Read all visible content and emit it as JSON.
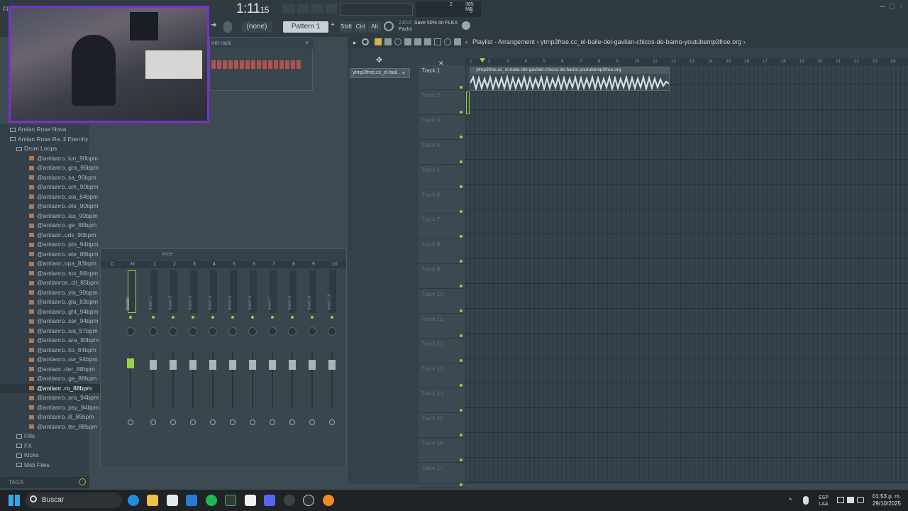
{
  "app": {
    "title": "FL",
    "clock": "1:11",
    "clock_small": "15",
    "cpu": "2",
    "mem": "385 MB",
    "mem2": "0"
  },
  "toolbar": {
    "pattern_label": "Pattern 1",
    "none_label": "(none)",
    "shift": "Shift",
    "ctrl": "Ctrl",
    "alt": "Alt",
    "promo_date": "23/10",
    "promo_text": "Save 50% on FLEX",
    "promo_sub": "Packs"
  },
  "channel_rack": {
    "title": "nel rack"
  },
  "browser": {
    "items": [
      {
        "label": "Antian Rose Nova",
        "kind": "folder",
        "indent": 1
      },
      {
        "label": "Antian Rose Re..ll Eternity",
        "kind": "folder-open",
        "indent": 1
      },
      {
        "label": "Drum Loops",
        "kind": "folder-open",
        "indent": 2
      },
      {
        "label": "@antianro..lun_90bpm",
        "kind": "file",
        "indent": 3
      },
      {
        "label": "@antianro..gra_96bpm",
        "kind": "file",
        "indent": 3
      },
      {
        "label": "@antianro..sa_96bpm",
        "kind": "file",
        "indent": 3
      },
      {
        "label": "@antianro..um_90bpm",
        "kind": "file",
        "indent": 3
      },
      {
        "label": "@antianro..ola_84bpm",
        "kind": "file",
        "indent": 3
      },
      {
        "label": "@antianro..ote_90bpm",
        "kind": "file",
        "indent": 3
      },
      {
        "label": "@antianro..las_90bpm",
        "kind": "file",
        "indent": 3
      },
      {
        "label": "@antianro..ge_88bpm",
        "kind": "file",
        "indent": 3
      },
      {
        "label": "@antianr..uds_90bpm",
        "kind": "file",
        "indent": 3
      },
      {
        "label": "@antianro..pto_94bpm",
        "kind": "file",
        "indent": 3
      },
      {
        "label": "@antianro..ate_88bpm",
        "kind": "file",
        "indent": 3
      },
      {
        "label": "@antianr..opa_83bpm",
        "kind": "file",
        "indent": 3
      },
      {
        "label": "@antianro..tus_86bpm",
        "kind": "file",
        "indent": 3
      },
      {
        "label": "@antianros..cll_85bpm",
        "kind": "file",
        "indent": 3
      },
      {
        "label": "@antianro..yla_90bpm",
        "kind": "file",
        "indent": 3
      },
      {
        "label": "@antianro..gla_83bpm",
        "kind": "file",
        "indent": 3
      },
      {
        "label": "@antianro..ght_94bpm",
        "kind": "file",
        "indent": 3
      },
      {
        "label": "@antianro..sar_94bpm",
        "kind": "file",
        "indent": 3
      },
      {
        "label": "@antianro..iva_87bpm",
        "kind": "file",
        "indent": 3
      },
      {
        "label": "@antianro..ara_90bpm",
        "kind": "file",
        "indent": 3
      },
      {
        "label": "@antianro..ito_84bpm",
        "kind": "file",
        "indent": 3
      },
      {
        "label": "@antianro..ow_94bpm",
        "kind": "file",
        "indent": 3
      },
      {
        "label": "@antianr..der_88bpm",
        "kind": "file",
        "indent": 3
      },
      {
        "label": "@antianro..ge_88bpm",
        "kind": "file",
        "indent": 3
      },
      {
        "label": "@antianr..ro_88bpm",
        "kind": "file-selected",
        "indent": 3
      },
      {
        "label": "@antianro..ara_94bpm",
        "kind": "file",
        "indent": 3
      },
      {
        "label": "@antianro..psy_84bpm",
        "kind": "file",
        "indent": 3
      },
      {
        "label": "@antianro..ill_85bpm",
        "kind": "file",
        "indent": 3
      },
      {
        "label": "@antianro..ter_88bpm",
        "kind": "file",
        "indent": 3
      },
      {
        "label": "Fills",
        "kind": "folder",
        "indent": 2
      },
      {
        "label": "FX",
        "kind": "folder",
        "indent": 2
      },
      {
        "label": "Kicks",
        "kind": "folder",
        "indent": 2
      },
      {
        "label": "Midi Files",
        "kind": "folder",
        "indent": 2
      }
    ],
    "tags_label": "TAGS"
  },
  "mixer": {
    "header_label": "Wide",
    "master_label": "Master",
    "channels": [
      "Insert 1",
      "Insert 2",
      "Insert 3",
      "Insert 4",
      "Insert 5",
      "Insert 6",
      "Insert 7",
      "Insert 8",
      "Insert 9",
      "Insert 10"
    ],
    "channel_numbers": [
      "C",
      "M",
      "1",
      "2",
      "3",
      "4",
      "5",
      "6",
      "7",
      "8",
      "9",
      "10"
    ]
  },
  "playlist": {
    "breadcrumb": "Playlist - Arrangement › ytmp3free.cc_el-baile-del-gavilan-chicos-de-barrio-youtubemp3free.org ›",
    "picker_item": "ytmp3free.cc_el-bail..",
    "clip_title": "ytmp3free.cc_el-baile-del-gavilan-chicos-de-barrio-youtubemp3free.org",
    "ruler": [
      "1",
      "2",
      "3",
      "4",
      "5",
      "6",
      "7",
      "8",
      "9",
      "10",
      "11",
      "12",
      "13",
      "14",
      "15",
      "16",
      "17",
      "18",
      "19",
      "20",
      "21",
      "22",
      "23",
      "24"
    ],
    "tracks": [
      "Track 1",
      "Track 2",
      "Track 3",
      "Track 4",
      "Track 5",
      "Track 6",
      "Track 7",
      "Track 8",
      "Track 9",
      "Track 10",
      "Track 11",
      "Track 12",
      "Track 13",
      "Track 14",
      "Track 15",
      "Track 16",
      "Track 17"
    ]
  },
  "taskbar": {
    "search_placeholder": "Buscar",
    "lang": "ESP",
    "lang2": "LAA",
    "time": "01:53 p. m.",
    "date": "29/10/2025"
  },
  "colors": {
    "accent_green": "#9ad14b",
    "webcam_border": "#7a2fd0",
    "bg": "#3d4a52"
  }
}
